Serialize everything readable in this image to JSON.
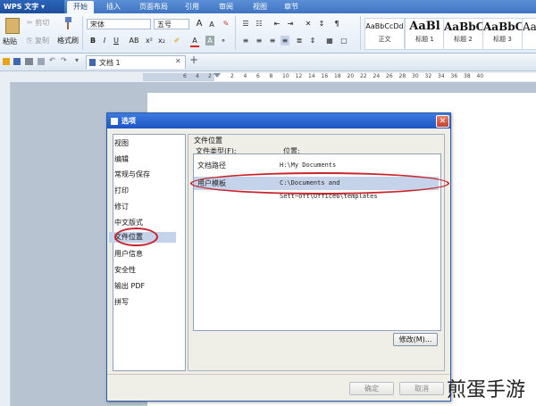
{
  "app": {
    "logo": "WPS 文字"
  },
  "menu_tabs": [
    "开始",
    "插入",
    "页面布局",
    "引用",
    "审阅",
    "视图",
    "章节"
  ],
  "ribbon": {
    "paste_label": "粘贴",
    "cut_label": "剪切",
    "copy_label": "复制",
    "format_painter_label": "格式刷",
    "font_name": "宋体",
    "font_size": "五号",
    "styles": [
      {
        "preview": "AaBbCcDd",
        "caption": "正文"
      },
      {
        "preview": "AaBl",
        "caption": "标题 1"
      },
      {
        "preview": "AaBbC",
        "caption": "标题 2"
      },
      {
        "preview": "AaBbC",
        "caption": "标题 3"
      },
      {
        "preview": "AaBb",
        "caption": ""
      }
    ]
  },
  "document_tab": "文档 1",
  "ruler_numbers": [
    "6",
    "4",
    "2",
    "2",
    "4",
    "6",
    "8",
    "10",
    "12",
    "14",
    "16",
    "18",
    "20",
    "22",
    "24",
    "26",
    "28",
    "30",
    "32",
    "34",
    "36",
    "38",
    "40"
  ],
  "dialog": {
    "title": "选项",
    "nav_items": [
      "视图",
      "编辑",
      "常规与保存",
      "打印",
      "修订",
      "中文版式",
      "文件位置",
      "用户信息",
      "安全性",
      "输出 PDF",
      "拼写"
    ],
    "selected_nav": "文件位置",
    "group_title": "文件位置",
    "col_type": "文件类型(F):",
    "col_location": "位置:",
    "rows": [
      {
        "type": "文档路径",
        "location": "H:\\My Documents"
      },
      {
        "type": "用户模板",
        "location": "C:\\Documents and Sett~oft\\Office6\\templates"
      }
    ],
    "modify_button": "修改(M)...",
    "ok_button": "确定",
    "cancel_button": "取消"
  },
  "watermark": "煎蛋手游",
  "colors": {
    "titlebar": "#1d55c4",
    "highlight_ellipse": "#c8262c",
    "selection": "#c4d3ea"
  }
}
